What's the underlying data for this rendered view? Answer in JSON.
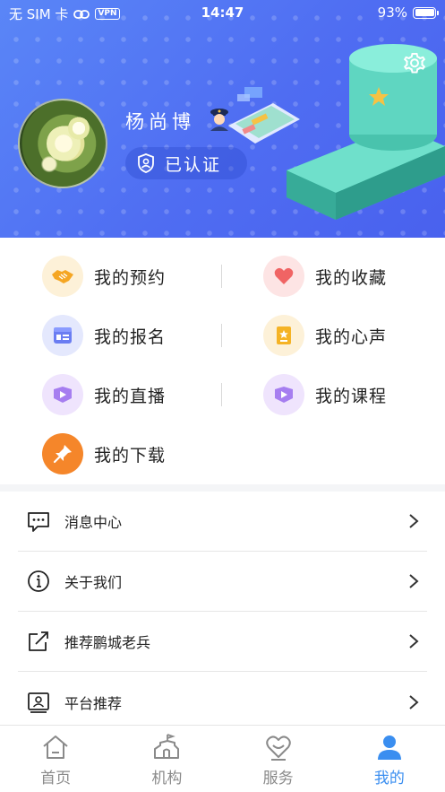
{
  "status_bar": {
    "carrier": "无 SIM 卡",
    "vpn": "VPN",
    "time": "14:47",
    "battery": "93%"
  },
  "profile": {
    "name": "杨尚博",
    "certified_label": "已认证"
  },
  "menu": {
    "items": [
      {
        "label": "我的预约",
        "icon": "handshake-icon",
        "color": "#f5a623"
      },
      {
        "label": "我的收藏",
        "icon": "heart-icon",
        "color": "#f06464"
      },
      {
        "label": "我的报名",
        "icon": "form-card-icon",
        "color": "#6a7df2"
      },
      {
        "label": "我的心声",
        "icon": "note-star-icon",
        "color": "#f5b325"
      },
      {
        "label": "我的直播",
        "icon": "live-play-icon",
        "color": "#a67ef0"
      },
      {
        "label": "我的课程",
        "icon": "course-play-icon",
        "color": "#a67ef0"
      },
      {
        "label": "我的下载",
        "icon": "pin-icon",
        "color": "#f5862a"
      }
    ]
  },
  "list": {
    "items": [
      {
        "label": "消息中心",
        "icon": "message-icon"
      },
      {
        "label": "关于我们",
        "icon": "info-icon"
      },
      {
        "label": "推荐鹏城老兵",
        "icon": "share-icon"
      },
      {
        "label": "平台推荐",
        "icon": "contact-card-icon"
      }
    ]
  },
  "tabbar": {
    "tabs": [
      {
        "label": "首页",
        "icon": "home-icon"
      },
      {
        "label": "机构",
        "icon": "institution-icon"
      },
      {
        "label": "服务",
        "icon": "service-heart-icon"
      },
      {
        "label": "我的",
        "icon": "person-icon"
      }
    ],
    "active_index": 3,
    "active_color": "#3a8ef0"
  }
}
